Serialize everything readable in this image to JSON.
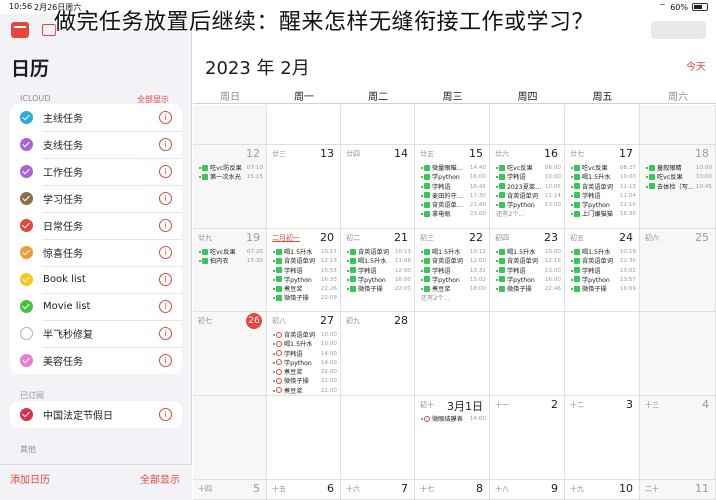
{
  "status": {
    "time": "10:56",
    "date": "2月26日周六",
    "battery": "60%"
  },
  "headline": "做完任务放置后继续：醒来怎样无缝衔接工作或学习？",
  "colors": {
    "accent": "#e9453b"
  },
  "sidebar": {
    "title": "日历",
    "icloud_label": "ICLOUD",
    "show_all": "全部显示",
    "items": [
      {
        "label": "主线任务",
        "color": "#2aa8e0",
        "checked": true
      },
      {
        "label": "支线任务",
        "color": "#a962d8",
        "checked": true
      },
      {
        "label": "工作任务",
        "color": "#a962d8",
        "checked": true
      },
      {
        "label": "学习任务",
        "color": "#8e6d4f",
        "checked": true
      },
      {
        "label": "日常任务",
        "color": "#e3493e",
        "checked": true
      },
      {
        "label": "惊喜任务",
        "color": "#f09a37",
        "checked": true
      },
      {
        "label": "Book list",
        "color": "#f4c81c",
        "checked": true
      },
      {
        "label": "Movie list",
        "color": "#45c33c",
        "checked": true
      },
      {
        "label": "半飞秒修复",
        "color": "#ffffff",
        "checked": false
      },
      {
        "label": "美容任务",
        "color": "#e87bd2",
        "checked": true
      }
    ],
    "subscribed_label": "已订阅",
    "subscribed": [
      {
        "label": "中国法定节假日",
        "color": "#d9304a",
        "checked": true
      }
    ],
    "other_label": "其他",
    "add_calendar": "添加日历",
    "hide_all": "全部显示"
  },
  "calendar": {
    "month_title": "2023 年 2月",
    "today": "今天",
    "weekdays": [
      "周日",
      "周一",
      "周二",
      "周三",
      "周四",
      "周五",
      "周六"
    ],
    "weeks": [
      [
        {
          "lunar": "",
          "day": ""
        },
        {
          "lunar": "",
          "day": ""
        },
        {
          "lunar": "",
          "day": ""
        },
        {
          "lunar": "",
          "day": ""
        },
        {
          "lunar": "",
          "day": ""
        },
        {
          "lunar": "",
          "day": ""
        },
        {
          "lunar": "",
          "day": ""
        }
      ],
      [
        {
          "lunar": "",
          "day": "12",
          "grey": true,
          "events": [
            {
              "k": "tick",
              "n": "吃vc防反果",
              "t": "07:10"
            },
            {
              "k": "tick",
              "n": "第一次水光",
              "t": "15:15"
            }
          ]
        },
        {
          "lunar": "廿三",
          "day": "13",
          "events": []
        },
        {
          "lunar": "廿四",
          "day": "14",
          "events": []
        },
        {
          "lunar": "廿五",
          "day": "15",
          "events": [
            {
              "k": "tick",
              "n": "微量眼瞄…",
              "t": "14:40"
            },
            {
              "k": "tick",
              "n": "学python",
              "t": "16:00"
            },
            {
              "k": "tick",
              "n": "学韩语",
              "t": "16:45"
            },
            {
              "k": "tick",
              "n": "麦田的守…",
              "t": "17:30"
            },
            {
              "k": "tick",
              "n": "背英语单…",
              "t": "21:40"
            },
            {
              "k": "tick",
              "n": "拿电瓶",
              "t": "23:00"
            }
          ]
        },
        {
          "lunar": "廿六",
          "day": "16",
          "events": [
            {
              "k": "tick",
              "n": "吃vc反果",
              "t": "08:00"
            },
            {
              "k": "tick",
              "n": "学韩语",
              "t": "10:00"
            },
            {
              "k": "tick",
              "n": "2023夏菜…",
              "t": "10:05"
            },
            {
              "k": "tick",
              "n": "背英语单词",
              "t": "11:14"
            },
            {
              "k": "tick",
              "n": "学python",
              "t": "13:00"
            },
            {
              "k": "more",
              "n": "还有2个…",
              "t": ""
            }
          ]
        },
        {
          "lunar": "廿七",
          "day": "17",
          "events": [
            {
              "k": "tick",
              "n": "吃vc反果",
              "t": "08:27"
            },
            {
              "k": "tick",
              "n": "喝1.5升水",
              "t": "10:00"
            },
            {
              "k": "tick",
              "n": "背英语单词",
              "t": "12:13"
            },
            {
              "k": "tick",
              "n": "学韩语",
              "t": "11:04"
            },
            {
              "k": "tick",
              "n": "学python",
              "t": "12:10"
            },
            {
              "k": "tick",
              "n": "上门嫌猫猫",
              "t": "16:30"
            }
          ]
        },
        {
          "lunar": "",
          "day": "18",
          "grey": true,
          "events": [
            {
              "k": "tick",
              "n": "童叙眼睛",
              "t": "10:00"
            },
            {
              "k": "tick",
              "n": "吃vc反果",
              "t": "10:00"
            },
            {
              "k": "tick",
              "n": "去体检（写…",
              "t": "10:45"
            }
          ]
        }
      ],
      [
        {
          "lunar": "廿九",
          "day": "19",
          "grey": true,
          "events": [
            {
              "k": "tick",
              "n": "吃vc反果",
              "t": "07:20"
            },
            {
              "k": "tick",
              "n": "拍内衣",
              "t": "15:30"
            }
          ]
        },
        {
          "lunar": "二月初一",
          "day": "20",
          "red": true,
          "events": [
            {
              "k": "tick",
              "n": "喝1.5升水",
              "t": "10:17"
            },
            {
              "k": "tick",
              "n": "背英语单词",
              "t": "12:13"
            },
            {
              "k": "tick",
              "n": "学韩语",
              "t": "15:55"
            },
            {
              "k": "tick",
              "n": "学python",
              "t": "16:33"
            },
            {
              "k": "tick",
              "n": "煮豆浆",
              "t": "22:26"
            },
            {
              "k": "tick",
              "n": "微筷子操",
              "t": "22:09"
            }
          ]
        },
        {
          "lunar": "初二",
          "day": "21",
          "events": [
            {
              "k": "tick",
              "n": "背英语单词",
              "t": "10:13"
            },
            {
              "k": "tick",
              "n": "喝1.5升水",
              "t": "11:08"
            },
            {
              "k": "tick",
              "n": "学韩语",
              "t": "12:00"
            },
            {
              "k": "tick",
              "n": "学python",
              "t": "16:00"
            },
            {
              "k": "tick",
              "n": "微筷子操",
              "t": "22:00"
            }
          ]
        },
        {
          "lunar": "初三",
          "day": "22",
          "events": [
            {
              "k": "tick",
              "n": "喝1.5升水",
              "t": "10:12"
            },
            {
              "k": "tick",
              "n": "背英语单词",
              "t": "12:00"
            },
            {
              "k": "tick",
              "n": "学韩语",
              "t": "13:32"
            },
            {
              "k": "tick",
              "n": "学python",
              "t": "15:02"
            },
            {
              "k": "tick",
              "n": "煮豆浆",
              "t": "18:00"
            },
            {
              "k": "more",
              "n": "还有2个…",
              "t": ""
            }
          ]
        },
        {
          "lunar": "初四",
          "day": "23",
          "events": [
            {
              "k": "tick",
              "n": "喝1.5升水",
              "t": "10:00"
            },
            {
              "k": "tick",
              "n": "背英语单词",
              "t": "12:16"
            },
            {
              "k": "tick",
              "n": "学韩语",
              "t": "13:00"
            },
            {
              "k": "tick",
              "n": "学python",
              "t": "16:00"
            },
            {
              "k": "tick",
              "n": "微筷子操",
              "t": "22:46"
            }
          ]
        },
        {
          "lunar": "初五",
          "day": "24",
          "events": [
            {
              "k": "tick",
              "n": "喝1.5升水",
              "t": "10:19"
            },
            {
              "k": "tick",
              "n": "背英语单词",
              "t": "12:30"
            },
            {
              "k": "tick",
              "n": "学韩语",
              "t": "13:02"
            },
            {
              "k": "tick",
              "n": "学python",
              "t": "13:57"
            },
            {
              "k": "tick",
              "n": "微筷子操",
              "t": "16:09"
            }
          ]
        },
        {
          "lunar": "初六",
          "day": "25",
          "grey": true,
          "events": []
        }
      ],
      [
        {
          "lunar": "初七",
          "day": "26",
          "today": true,
          "events": []
        },
        {
          "lunar": "初八",
          "day": "27",
          "events": [
            {
              "k": "ring",
              "n": "背英语单词",
              "t": "10:00"
            },
            {
              "k": "ring",
              "n": "喝1.5升水",
              "t": "10:00"
            },
            {
              "k": "ring",
              "n": "学韩语",
              "t": "14:00"
            },
            {
              "k": "ring",
              "n": "学python",
              "t": "14:00"
            },
            {
              "k": "ring",
              "n": "煮豆浆",
              "t": "22:00"
            },
            {
              "k": "ring",
              "n": "微筷子操",
              "t": "22:00"
            },
            {
              "k": "ring",
              "n": "煮豆浆",
              "t": "22:00"
            }
          ]
        },
        {
          "lunar": "初九",
          "day": "28",
          "events": []
        },
        {
          "lunar": "",
          "day": "",
          "events": []
        },
        {
          "lunar": "",
          "day": "",
          "events": []
        },
        {
          "lunar": "",
          "day": "",
          "events": []
        },
        {
          "lunar": "",
          "day": "",
          "events": []
        }
      ],
      [
        {
          "lunar": "",
          "day": "",
          "events": []
        },
        {
          "lunar": "",
          "day": "",
          "events": []
        },
        {
          "lunar": "",
          "day": "",
          "events": []
        },
        {
          "lunar": "初十",
          "day": "3月1日",
          "events": [
            {
              "k": "ring",
              "n": "微眼结膜表",
              "t": "14:00"
            }
          ]
        },
        {
          "lunar": "十一",
          "day": "2",
          "events": []
        },
        {
          "lunar": "十二",
          "day": "3",
          "events": []
        },
        {
          "lunar": "十三",
          "day": "4",
          "grey": true,
          "events": []
        }
      ],
      [
        {
          "lunar": "十四",
          "day": "5",
          "grey": true,
          "events": []
        },
        {
          "lunar": "十五",
          "day": "6",
          "events": []
        },
        {
          "lunar": "十六",
          "day": "7",
          "events": []
        },
        {
          "lunar": "十七",
          "day": "8",
          "events": []
        },
        {
          "lunar": "十八",
          "day": "9",
          "events": []
        },
        {
          "lunar": "十九",
          "day": "10",
          "events": []
        },
        {
          "lunar": "二十",
          "day": "11",
          "grey": true,
          "events": []
        }
      ]
    ]
  }
}
